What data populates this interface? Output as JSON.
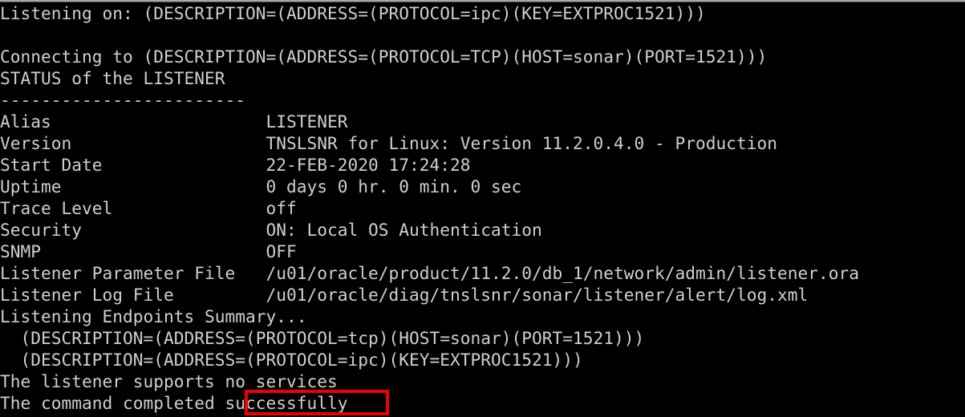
{
  "terminal": {
    "title": "lsnrctl status output",
    "background_color": "#000000",
    "text_color": "#cfcfcf",
    "top_rule_color": "#a8a8a8",
    "lines": [
      "Listening on: (DESCRIPTION=(ADDRESS=(PROTOCOL=ipc)(KEY=EXTPROC1521)))",
      "",
      "Connecting to (DESCRIPTION=(ADDRESS=(PROTOCOL=TCP)(HOST=sonar)(PORT=1521)))",
      "STATUS of the LISTENER",
      "------------------------",
      "Alias                     LISTENER",
      "Version                   TNSLSNR for Linux: Version 11.2.0.4.0 - Production",
      "Start Date                22-FEB-2020 17:24:28",
      "Uptime                    0 days 0 hr. 0 min. 0 sec",
      "Trace Level               off",
      "Security                  ON: Local OS Authentication",
      "SNMP                      OFF",
      "Listener Parameter File   /u01/oracle/product/11.2.0/db_1/network/admin/listener.ora",
      "Listener Log File         /u01/oracle/diag/tnslsnr/sonar/listener/alert/log.xml",
      "Listening Endpoints Summary...",
      "  (DESCRIPTION=(ADDRESS=(PROTOCOL=tcp)(HOST=sonar)(PORT=1521)))",
      "  (DESCRIPTION=(ADDRESS=(PROTOCOL=ipc)(KEY=EXTPROC1521)))",
      "The listener supports no services",
      "The command completed successfully"
    ],
    "status_fields": [
      {
        "label": "Alias",
        "value": "LISTENER"
      },
      {
        "label": "Version",
        "value": "TNSLSNR for Linux: Version 11.2.0.4.0 - Production"
      },
      {
        "label": "Start Date",
        "value": "22-FEB-2020 17:24:28"
      },
      {
        "label": "Uptime",
        "value": "0 days 0 hr. 0 min. 0 sec"
      },
      {
        "label": "Trace Level",
        "value": "off"
      },
      {
        "label": "Security",
        "value": "ON: Local OS Authentication"
      },
      {
        "label": "SNMP",
        "value": "OFF"
      },
      {
        "label": "Listener Parameter File",
        "value": "/u01/oracle/product/11.2.0/db_1/network/admin/listener.ora"
      },
      {
        "label": "Listener Log File",
        "value": "/u01/oracle/diag/tnslsnr/sonar/listener/alert/log.xml"
      }
    ],
    "endpoints": [
      "(DESCRIPTION=(ADDRESS=(PROTOCOL=tcp)(HOST=sonar)(PORT=1521)))",
      "(DESCRIPTION=(ADDRESS=(PROTOCOL=ipc)(KEY=EXTPROC1521)))"
    ]
  },
  "annotation": {
    "highlighted_text": "successfully",
    "color": "#ee0000",
    "shape": "rectangle"
  }
}
